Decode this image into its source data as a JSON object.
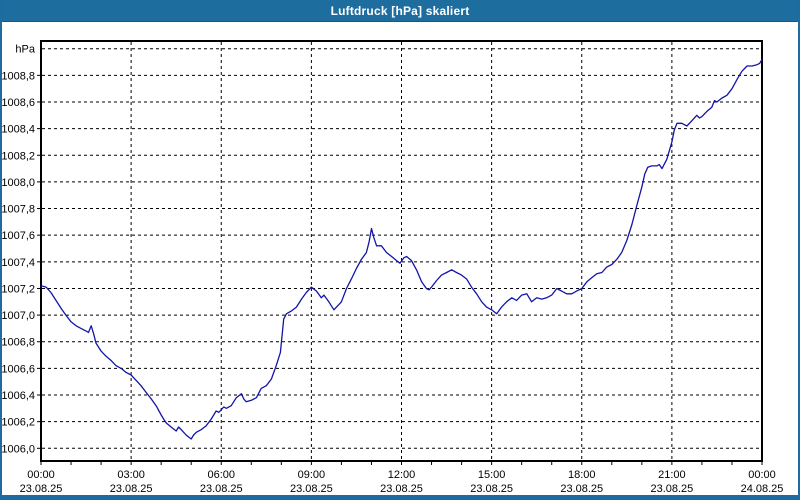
{
  "window": {
    "title": "Luftdruck [hPa] skaliert",
    "title_bg": "#1e6d9f",
    "frame_color": "#1e6b9f",
    "bg": "#ffffff"
  },
  "chart_data": {
    "type": "line",
    "title": "Luftdruck [hPa] skaliert",
    "unit_label": "hPa",
    "line_color": "#1414a8",
    "grid": "dashed",
    "legend": "none",
    "ylim": [
      1005.9,
      1009.06
    ],
    "xlim_hours": [
      0,
      24
    ],
    "y_grid_step": 0.2,
    "y_grid_values": [
      1006.0,
      1006.2,
      1006.4,
      1006.6,
      1006.8,
      1007.0,
      1007.2,
      1007.4,
      1007.6,
      1007.8,
      1008.0,
      1008.2,
      1008.4,
      1008.6,
      1008.8,
      1009.0
    ],
    "y_ticks": [
      {
        "v": 1006.0,
        "label": "1006,0"
      },
      {
        "v": 1006.2,
        "label": "1006,2"
      },
      {
        "v": 1006.4,
        "label": "1006,4"
      },
      {
        "v": 1006.6,
        "label": "1006,6"
      },
      {
        "v": 1006.8,
        "label": "1006,8"
      },
      {
        "v": 1007.0,
        "label": "1007,0"
      },
      {
        "v": 1007.2,
        "label": "1007,2"
      },
      {
        "v": 1007.4,
        "label": "1007,4"
      },
      {
        "v": 1007.6,
        "label": "1007,6"
      },
      {
        "v": 1007.8,
        "label": "1007,8"
      },
      {
        "v": 1008.0,
        "label": "1008,0"
      },
      {
        "v": 1008.2,
        "label": "1008,2"
      },
      {
        "v": 1008.4,
        "label": "1008,4"
      },
      {
        "v": 1008.6,
        "label": "1008,6"
      },
      {
        "v": 1008.8,
        "label": "1008,8"
      }
    ],
    "x_ticks": [
      {
        "hour": 0,
        "time": "00:00",
        "date": "23.08.25"
      },
      {
        "hour": 3,
        "time": "03:00",
        "date": "23.08.25"
      },
      {
        "hour": 6,
        "time": "06:00",
        "date": "23.08.25"
      },
      {
        "hour": 9,
        "time": "09:00",
        "date": "23.08.25"
      },
      {
        "hour": 12,
        "time": "12:00",
        "date": "23.08.25"
      },
      {
        "hour": 15,
        "time": "15:00",
        "date": "23.08.25"
      },
      {
        "hour": 18,
        "time": "18:00",
        "date": "23.08.25"
      },
      {
        "hour": 21,
        "time": "21:00",
        "date": "23.08.25"
      },
      {
        "hour": 24,
        "time": "00:00",
        "date": "24.08.25"
      }
    ],
    "minor_tick_every_hours": 1,
    "series": [
      {
        "name": "Luftdruck",
        "points": [
          [
            0,
            1007.22
          ],
          [
            0.17,
            1007.21
          ],
          [
            0.33,
            1007.17
          ],
          [
            0.5,
            1007.11
          ],
          [
            0.67,
            1007.05
          ],
          [
            0.83,
            1007.0
          ],
          [
            1.0,
            1006.95
          ],
          [
            1.17,
            1006.92
          ],
          [
            1.33,
            1006.9
          ],
          [
            1.5,
            1006.88
          ],
          [
            1.58,
            1006.87
          ],
          [
            1.67,
            1006.92
          ],
          [
            1.75,
            1006.86
          ],
          [
            1.83,
            1006.79
          ],
          [
            2.0,
            1006.73
          ],
          [
            2.17,
            1006.69
          ],
          [
            2.33,
            1006.66
          ],
          [
            2.5,
            1006.62
          ],
          [
            2.67,
            1006.6
          ],
          [
            2.83,
            1006.57
          ],
          [
            3.0,
            1006.55
          ],
          [
            3.17,
            1006.51
          ],
          [
            3.33,
            1006.47
          ],
          [
            3.5,
            1006.42
          ],
          [
            3.67,
            1006.37
          ],
          [
            3.83,
            1006.32
          ],
          [
            4.0,
            1006.25
          ],
          [
            4.08,
            1006.22
          ],
          [
            4.17,
            1006.19
          ],
          [
            4.33,
            1006.16
          ],
          [
            4.5,
            1006.13
          ],
          [
            4.58,
            1006.16
          ],
          [
            4.67,
            1006.14
          ],
          [
            4.83,
            1006.1
          ],
          [
            5.0,
            1006.07
          ],
          [
            5.08,
            1006.1
          ],
          [
            5.17,
            1006.12
          ],
          [
            5.33,
            1006.14
          ],
          [
            5.5,
            1006.17
          ],
          [
            5.67,
            1006.22
          ],
          [
            5.83,
            1006.28
          ],
          [
            5.92,
            1006.27
          ],
          [
            6.0,
            1006.29
          ],
          [
            6.08,
            1006.31
          ],
          [
            6.17,
            1006.3
          ],
          [
            6.33,
            1006.32
          ],
          [
            6.5,
            1006.38
          ],
          [
            6.67,
            1006.41
          ],
          [
            6.75,
            1006.37
          ],
          [
            6.83,
            1006.35
          ],
          [
            7.0,
            1006.36
          ],
          [
            7.17,
            1006.38
          ],
          [
            7.33,
            1006.45
          ],
          [
            7.5,
            1006.47
          ],
          [
            7.67,
            1006.52
          ],
          [
            7.83,
            1006.62
          ],
          [
            7.97,
            1006.72
          ],
          [
            8.08,
            1006.97
          ],
          [
            8.17,
            1007.01
          ],
          [
            8.33,
            1007.03
          ],
          [
            8.5,
            1007.06
          ],
          [
            8.67,
            1007.12
          ],
          [
            8.83,
            1007.17
          ],
          [
            9.0,
            1007.21
          ],
          [
            9.17,
            1007.18
          ],
          [
            9.33,
            1007.13
          ],
          [
            9.42,
            1007.15
          ],
          [
            9.58,
            1007.1
          ],
          [
            9.75,
            1007.04
          ],
          [
            9.92,
            1007.08
          ],
          [
            10.0,
            1007.1
          ],
          [
            10.17,
            1007.2
          ],
          [
            10.33,
            1007.27
          ],
          [
            10.5,
            1007.35
          ],
          [
            10.67,
            1007.42
          ],
          [
            10.83,
            1007.47
          ],
          [
            10.92,
            1007.55
          ],
          [
            11.0,
            1007.65
          ],
          [
            11.08,
            1007.58
          ],
          [
            11.17,
            1007.52
          ],
          [
            11.33,
            1007.52
          ],
          [
            11.5,
            1007.47
          ],
          [
            11.67,
            1007.44
          ],
          [
            11.83,
            1007.41
          ],
          [
            11.95,
            1007.39
          ],
          [
            12.08,
            1007.43
          ],
          [
            12.17,
            1007.44
          ],
          [
            12.33,
            1007.41
          ],
          [
            12.5,
            1007.34
          ],
          [
            12.67,
            1007.25
          ],
          [
            12.83,
            1007.2
          ],
          [
            12.92,
            1007.19
          ],
          [
            13.0,
            1007.21
          ],
          [
            13.17,
            1007.26
          ],
          [
            13.33,
            1007.3
          ],
          [
            13.5,
            1007.32
          ],
          [
            13.67,
            1007.34
          ],
          [
            13.83,
            1007.32
          ],
          [
            14.0,
            1007.3
          ],
          [
            14.17,
            1007.27
          ],
          [
            14.33,
            1007.21
          ],
          [
            14.5,
            1007.16
          ],
          [
            14.67,
            1007.1
          ],
          [
            14.83,
            1007.06
          ],
          [
            15.0,
            1007.04
          ],
          [
            15.17,
            1007.01
          ],
          [
            15.33,
            1007.06
          ],
          [
            15.5,
            1007.1
          ],
          [
            15.67,
            1007.13
          ],
          [
            15.83,
            1007.11
          ],
          [
            16.0,
            1007.15
          ],
          [
            16.17,
            1007.16
          ],
          [
            16.33,
            1007.1
          ],
          [
            16.5,
            1007.13
          ],
          [
            16.67,
            1007.12
          ],
          [
            16.83,
            1007.13
          ],
          [
            17.0,
            1007.15
          ],
          [
            17.17,
            1007.2
          ],
          [
            17.33,
            1007.18
          ],
          [
            17.5,
            1007.16
          ],
          [
            17.67,
            1007.16
          ],
          [
            17.83,
            1007.18
          ],
          [
            18.0,
            1007.2
          ],
          [
            18.17,
            1007.25
          ],
          [
            18.33,
            1007.28
          ],
          [
            18.5,
            1007.31
          ],
          [
            18.67,
            1007.32
          ],
          [
            18.83,
            1007.36
          ],
          [
            19.0,
            1007.38
          ],
          [
            19.17,
            1007.42
          ],
          [
            19.33,
            1007.47
          ],
          [
            19.5,
            1007.56
          ],
          [
            19.67,
            1007.68
          ],
          [
            19.83,
            1007.82
          ],
          [
            20.0,
            1007.96
          ],
          [
            20.1,
            1008.06
          ],
          [
            20.2,
            1008.11
          ],
          [
            20.33,
            1008.12
          ],
          [
            20.5,
            1008.12
          ],
          [
            20.58,
            1008.13
          ],
          [
            20.67,
            1008.1
          ],
          [
            20.83,
            1008.17
          ],
          [
            21.0,
            1008.3
          ],
          [
            21.08,
            1008.39
          ],
          [
            21.17,
            1008.44
          ],
          [
            21.33,
            1008.44
          ],
          [
            21.5,
            1008.42
          ],
          [
            21.67,
            1008.46
          ],
          [
            21.83,
            1008.5
          ],
          [
            21.92,
            1008.48
          ],
          [
            22.0,
            1008.49
          ],
          [
            22.17,
            1008.53
          ],
          [
            22.33,
            1008.56
          ],
          [
            22.42,
            1008.61
          ],
          [
            22.5,
            1008.6
          ],
          [
            22.67,
            1008.63
          ],
          [
            22.83,
            1008.65
          ],
          [
            23.0,
            1008.7
          ],
          [
            23.17,
            1008.77
          ],
          [
            23.33,
            1008.83
          ],
          [
            23.5,
            1008.87
          ],
          [
            23.67,
            1008.87
          ],
          [
            23.83,
            1008.88
          ],
          [
            23.92,
            1008.89
          ],
          [
            24.0,
            1008.92
          ]
        ]
      }
    ]
  }
}
